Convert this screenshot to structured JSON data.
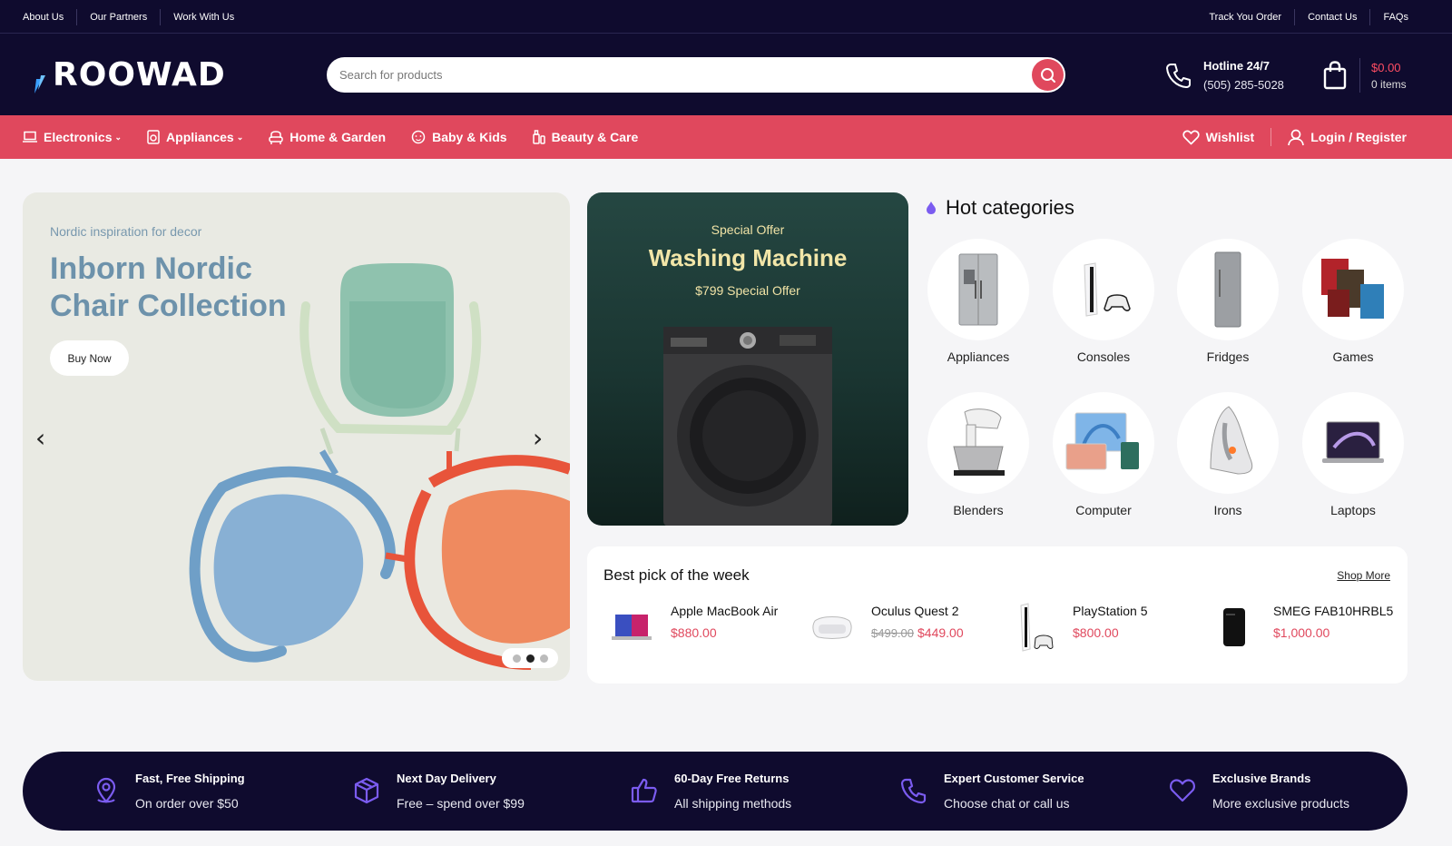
{
  "topbar": {
    "left_links": [
      "About Us",
      "Our Partners",
      "Work With Us"
    ],
    "right_links": [
      "Track You Order",
      "Contact Us",
      "FAQs"
    ]
  },
  "header": {
    "logo": "ROOWAD",
    "search_placeholder": "Search for products",
    "hotline_label": "Hotline 24/7",
    "hotline_number": "(505) 285-5028",
    "cart_amount": "$0.00",
    "cart_items": "0 items"
  },
  "nav": {
    "items": [
      {
        "label": "Electronics",
        "icon": "laptop-icon",
        "dropdown": true
      },
      {
        "label": "Appliances",
        "icon": "washer-icon",
        "dropdown": true
      },
      {
        "label": "Home & Garden",
        "icon": "armchair-icon",
        "dropdown": false
      },
      {
        "label": "Baby & Kids",
        "icon": "baby-icon",
        "dropdown": false
      },
      {
        "label": "Beauty & Care",
        "icon": "bottle-icon",
        "dropdown": false
      }
    ],
    "wishlist": "Wishlist",
    "login": "Login / Register"
  },
  "hero": {
    "subtitle": "Nordic inspiration for decor",
    "title": "Inborn Nordic Chair Collection",
    "button": "Buy Now",
    "slide_count": 3,
    "active_slide": 2
  },
  "offer": {
    "kicker": "Special Offer",
    "title": "Washing Machine",
    "price_line": "$799 Special Offer"
  },
  "hot_categories": {
    "title": "Hot categories",
    "items": [
      "Appliances",
      "Consoles",
      "Fridges",
      "Games",
      "Blenders",
      "Computer",
      "Irons",
      "Laptops"
    ]
  },
  "best_pick": {
    "title": "Best pick of the week",
    "shop_more": "Shop More",
    "products": [
      {
        "name": "Apple MacBook Air",
        "price": "$880.00",
        "old_price": ""
      },
      {
        "name": "Oculus Quest 2",
        "price": "$449.00",
        "old_price": "$499.00"
      },
      {
        "name": "PlayStation 5",
        "price": "$800.00",
        "old_price": ""
      },
      {
        "name": "SMEG FAB10HRBL5",
        "price": "$1,000.00",
        "old_price": ""
      }
    ]
  },
  "features": [
    {
      "title": "Fast, Free Shipping",
      "desc": "On order over $50",
      "icon": "location-pin-icon"
    },
    {
      "title": "Next Day Delivery",
      "desc": "Free – spend over $99",
      "icon": "box-icon"
    },
    {
      "title": "60-Day Free Returns",
      "desc": "All shipping methods",
      "icon": "thumbs-up-icon"
    },
    {
      "title": "Expert Customer Service",
      "desc": "Choose chat or call us",
      "icon": "phone-icon"
    },
    {
      "title": "Exclusive Brands",
      "desc": "More exclusive products",
      "icon": "heart-icon"
    }
  ],
  "colors": {
    "navy": "#0f0b2e",
    "accent_red": "#e0485d",
    "offer_green": "#1f3c38",
    "hero_bg": "#e9eae3",
    "icon_purple": "#7b5cf0"
  }
}
